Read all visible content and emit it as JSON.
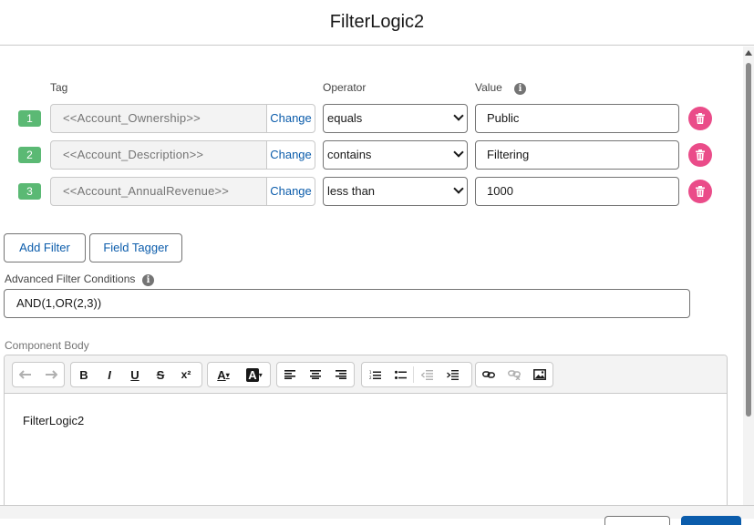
{
  "header": {
    "title": "FilterLogic2"
  },
  "columns": {
    "tag": "Tag",
    "operator": "Operator",
    "value": "Value"
  },
  "icons": {
    "info": "info-icon",
    "delete": "trash-icon",
    "chevron": "chevron-down-icon"
  },
  "filters": [
    {
      "num": "1",
      "tag": "<<Account_Ownership>>",
      "change": "Change",
      "operator": "equals",
      "value": "Public"
    },
    {
      "num": "2",
      "tag": "<<Account_Description>>",
      "change": "Change",
      "operator": "contains",
      "value": "Filtering"
    },
    {
      "num": "3",
      "tag": "<<Account_AnnualRevenue>>",
      "change": "Change",
      "operator": "less than",
      "value": "1000"
    }
  ],
  "actions": {
    "add_filter": "Add Filter",
    "field_tagger": "Field Tagger"
  },
  "advanced": {
    "label": "Advanced Filter Conditions",
    "value": "AND(1,OR(2,3))"
  },
  "component_body": {
    "label": "Component Body",
    "content": "FilterLogic2",
    "toolbar": {
      "bold": "B",
      "italic": "I",
      "underline": "U",
      "strike": "S",
      "clear": "x²",
      "text_color": "A",
      "bg_color": "A"
    }
  },
  "colors": {
    "accent": "#0b5cab",
    "badge": "#5bb974",
    "delete": "#ea4c89"
  }
}
